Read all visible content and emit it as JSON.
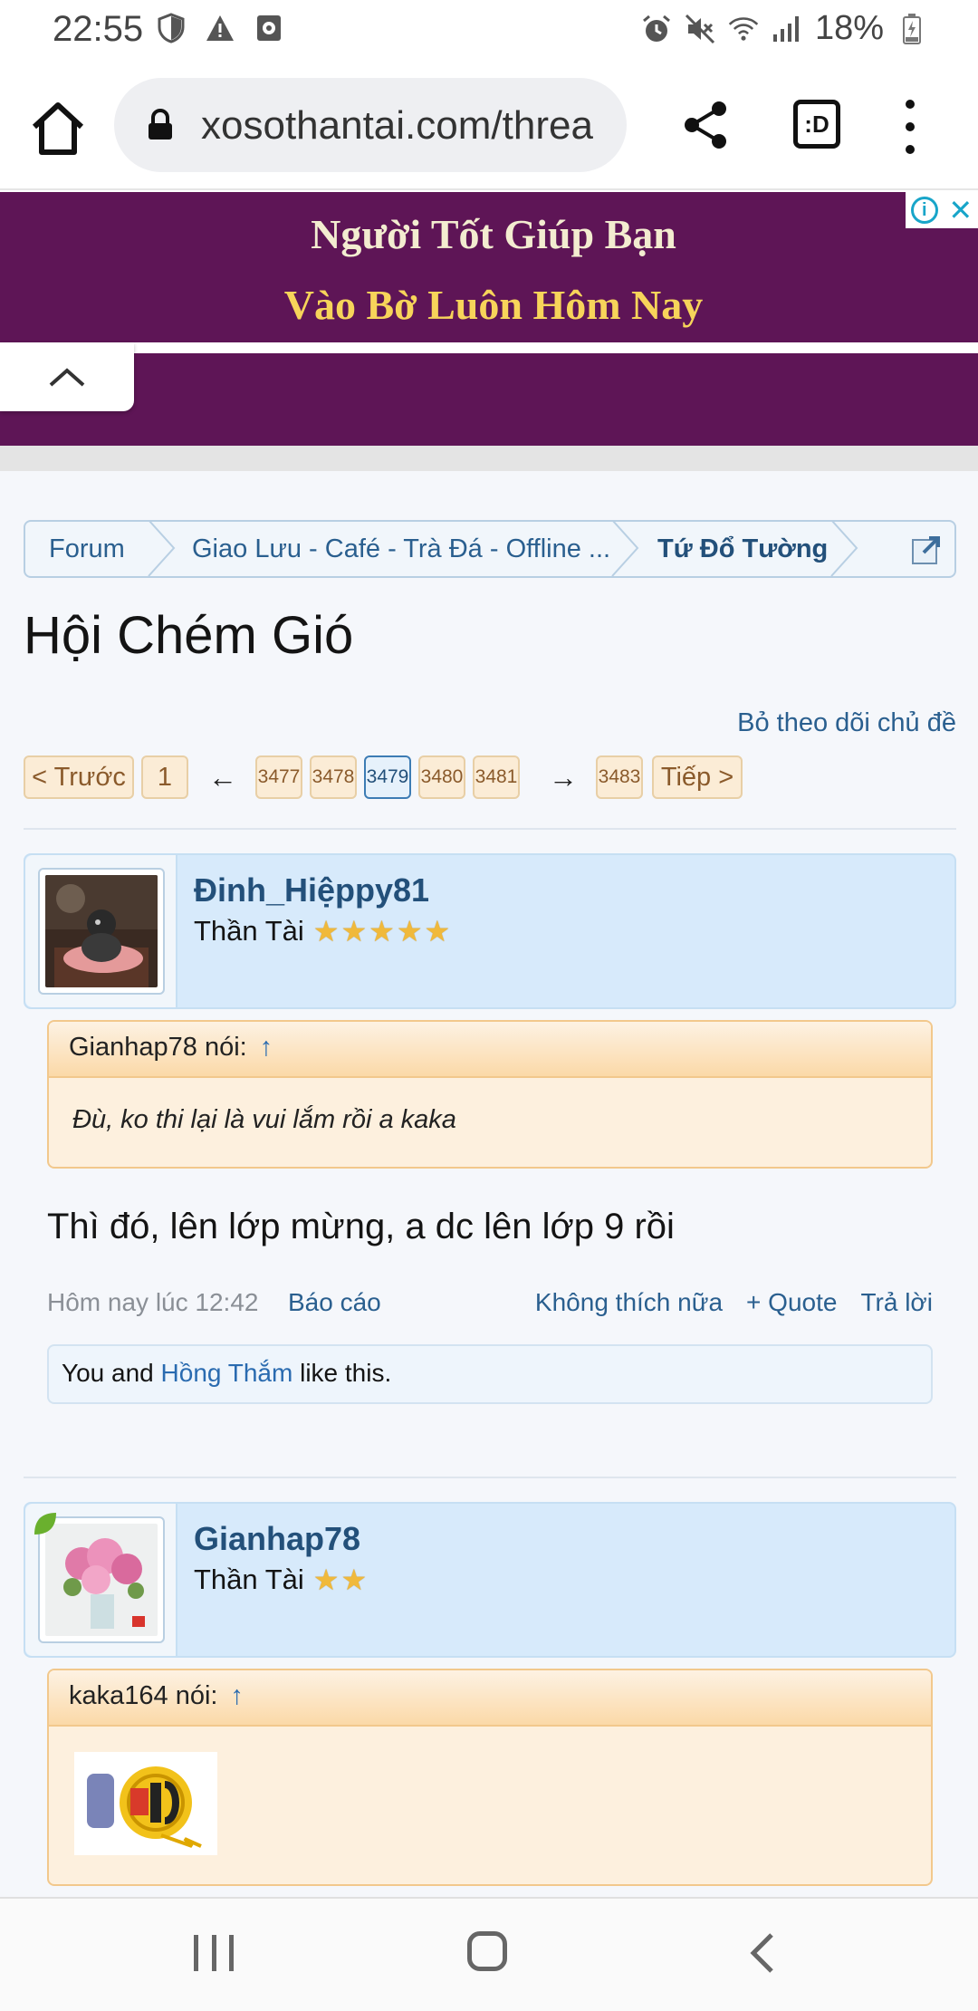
{
  "status_bar": {
    "time": "22:55",
    "battery": "18%",
    "icons": [
      "shield-icon",
      "warning-icon",
      "record-icon",
      "alarm-icon",
      "mute-icon",
      "wifi-icon",
      "signal-icon",
      "battery-charging-icon"
    ]
  },
  "browser": {
    "url": "xosothantai.com/threa",
    "icons": [
      "home-icon",
      "lock-icon",
      "share-icon",
      "tab-switcher-icon",
      "more-menu-icon"
    ],
    "tabs_label": ":D"
  },
  "ad": {
    "line1": "Người Tốt Giúp Bạn",
    "line2": "Vào Bờ Luôn Hôm Nay",
    "background": "#5e1556"
  },
  "breadcrumb": {
    "items": [
      "Forum",
      "Giao Lưu - Café - Trà Đá - Offline ...",
      "Tứ Đổ Tường"
    ]
  },
  "page": {
    "title": "Hội Chém Gió",
    "unwatch": "Bỏ theo dõi chủ đề"
  },
  "pagination": {
    "prev": "< Trước",
    "first": "1",
    "left_arrow": "←",
    "pages": [
      "3477",
      "3478",
      "3479",
      "3480",
      "3481"
    ],
    "current": "3479",
    "right_arrow": "→",
    "last": "3483",
    "next": "Tiếp >"
  },
  "posts": [
    {
      "username": "Đinh_Hiệppy81",
      "user_title": "Thần Tài",
      "stars": 5,
      "quote_author": "Gianhap78 nói:",
      "quote_arrow": "↑",
      "quote_text": "Đù, ko thi lại là vui lắm rồi a kaka",
      "message": "Thì đó, lên lớp mừng, a dc lên lớp 9 rồi",
      "date": "Hôm nay lúc 12:42",
      "report": "Báo cáo",
      "unlike": "Không thích nữa",
      "quote_btn": "+ Quote",
      "reply": "Trả lời",
      "likes_prefix": "You and ",
      "likes_user": "Hồng Thắm",
      "likes_suffix": " like this."
    },
    {
      "username": "Gianhap78",
      "user_title": "Thần Tài",
      "stars": 2,
      "quote_author": "kaka164 nói:",
      "quote_arrow": "↑"
    }
  ],
  "colors": {
    "link": "#2a5f8f",
    "star": "#f0b93b",
    "userbar": "#d7eafb",
    "quote_bg": "#fdf0de"
  }
}
